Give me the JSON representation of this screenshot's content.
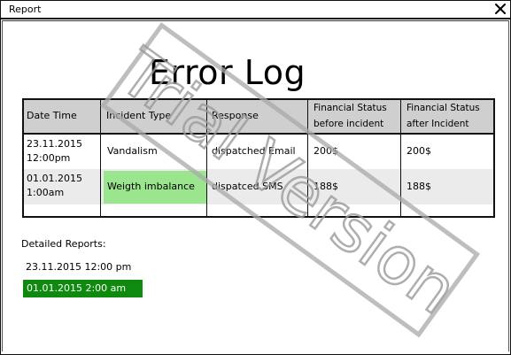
{
  "window": {
    "title": "Report",
    "close_icon": "close-icon"
  },
  "page": {
    "heading": "Error Log"
  },
  "table": {
    "columns": [
      "Date Time",
      "Incident Type",
      "Response",
      [
        "Financial Status",
        "before incident"
      ],
      [
        "Financial Status",
        "after Incident"
      ]
    ],
    "rows": [
      {
        "datetime": [
          "23.11.2015",
          "12:00pm"
        ],
        "incident_type": "Vandalism",
        "response": "dispatched Email",
        "before": "200$",
        "after": "200$"
      },
      {
        "datetime": [
          "01.01.2015",
          "1:00am"
        ],
        "incident_type": "Weigth imbalance",
        "response": "dispatced SMS",
        "before": "188$",
        "after": "188$"
      }
    ],
    "colors": {
      "header_bg": "#cfcfcf",
      "alt_row_bg": "#ebebeb",
      "highlight_cell": "#9be58f"
    }
  },
  "detailed_reports": {
    "label": "Detailed Reports:",
    "items": [
      "23.11.2015 12:00 pm",
      "01.01.2015 2:00 am"
    ],
    "selected_index": 1,
    "selected_color": "#0e8a0e"
  },
  "watermark": {
    "text": "Trial Version"
  }
}
